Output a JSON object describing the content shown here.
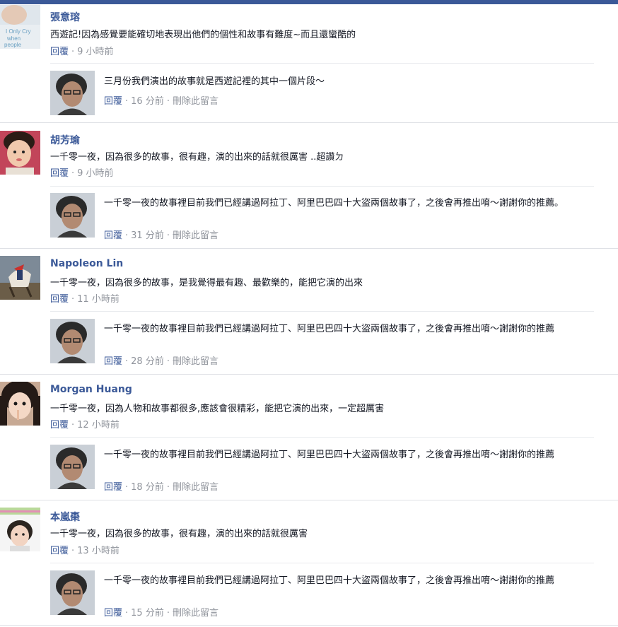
{
  "comments": [
    {
      "author": "張意瑢",
      "text": "西遊記!因為感覺要能確切地表現出他們的個性和故事有難度~而且還蠻酷的",
      "reply_label": "回覆",
      "time": "9 小時前",
      "reply": {
        "text": "三月份我們演出的故事就是西遊記裡的其中一個片段～",
        "reply_label": "回覆",
        "time": "16 分前",
        "delete_label": "刪除此留言"
      }
    },
    {
      "author": "胡芳瑜",
      "text": "一千零一夜，因為很多的故事，很有趣，演的出來的話就很厲害 ..超讚ㄉ",
      "reply_label": "回覆",
      "time": "9 小時前",
      "reply": {
        "text": "一千零一夜的故事裡目前我們已經講過阿拉丁、阿里巴巴四十大盜兩個故事了，之後會再推出唷～謝謝你的推薦。",
        "reply_label": "回覆",
        "time": "31 分前",
        "delete_label": "刪除此留言"
      }
    },
    {
      "author": "Napoleon Lin",
      "text": "一千零一夜，因為很多的故事，是我覺得最有趣、最歡樂的，能把它演的出來",
      "reply_label": "回覆",
      "time": "11 小時前",
      "reply": {
        "text": "一千零一夜的故事裡目前我們已經講過阿拉丁、阿里巴巴四十大盜兩個故事了，之後會再推出唷～謝謝你的推薦",
        "reply_label": "回覆",
        "time": "28 分前",
        "delete_label": "刪除此留言"
      }
    },
    {
      "author": "Morgan Huang",
      "text": "一千零一夜，因為人物和故事都很多,應該會很精彩，能把它演的出來，一定超厲害",
      "reply_label": "回覆",
      "time": "12 小時前",
      "reply": {
        "text": "一千零一夜的故事裡目前我們已經講過阿拉丁、阿里巴巴四十大盜兩個故事了，之後會再推出唷～謝謝你的推薦",
        "reply_label": "回覆",
        "time": "18 分前",
        "delete_label": "刪除此留言"
      }
    },
    {
      "author": "本嵐棗",
      "text": "一千零一夜，因為很多的故事，很有趣，演的出來的話就很厲害",
      "reply_label": "回覆",
      "time": "13 小時前",
      "reply": {
        "text": "一千零一夜的故事裡目前我們已經講過阿拉丁、阿里巴巴四十大盜兩個故事了，之後會再推出唷～謝謝你的推薦",
        "reply_label": "回覆",
        "time": "15 分前",
        "delete_label": "刪除此留言"
      }
    }
  ],
  "colors": {
    "link": "#3b5998",
    "meta": "#90949c",
    "separator": "#dfe1e6"
  }
}
